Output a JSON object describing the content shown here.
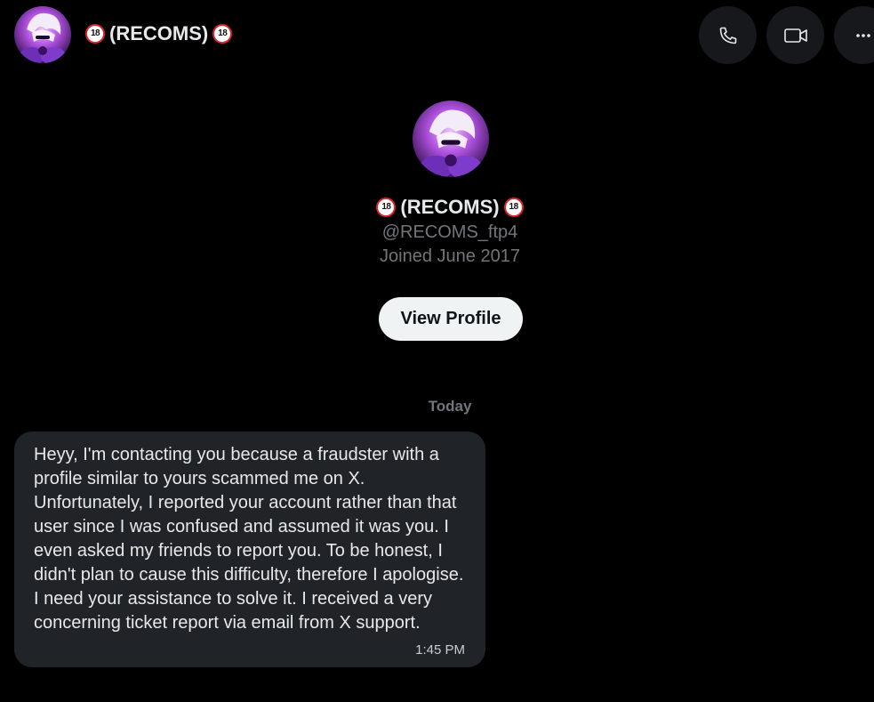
{
  "header": {
    "title": "(RECOMS)",
    "badge_text": "18",
    "avatar_icon": "avatar-image",
    "actions": [
      {
        "name": "call-button",
        "icon": "phone-icon"
      },
      {
        "name": "video-call-button",
        "icon": "video-icon"
      },
      {
        "name": "more-button",
        "icon": "more-icon"
      }
    ]
  },
  "profile": {
    "name": "(RECOMS)",
    "badge_text": "18",
    "handle": "@RECOMS_ftp4",
    "joined": "Joined June 2017",
    "view_profile_label": "View Profile"
  },
  "conversation": {
    "date_separator": "Today",
    "messages": [
      {
        "text": "Heyy, I'm contacting you because a fraudster with a profile similar to yours scammed me on X. Unfortunately, I reported your account rather than that user since I was confused and assumed it was you. I even asked my friends to report you. To be honest, I didn't plan to cause this difficulty, therefore I apologise. I need your assistance to solve it. I received a very concerning ticket report via email from X support.",
        "time": "1:45 PM"
      }
    ]
  },
  "colors": {
    "background": "#000000",
    "bubble": "#202327",
    "primary_text": "#e7e9ea",
    "secondary_text": "#71767b",
    "button_bg": "#eff3f4",
    "badge_ring": "#e0242e"
  }
}
